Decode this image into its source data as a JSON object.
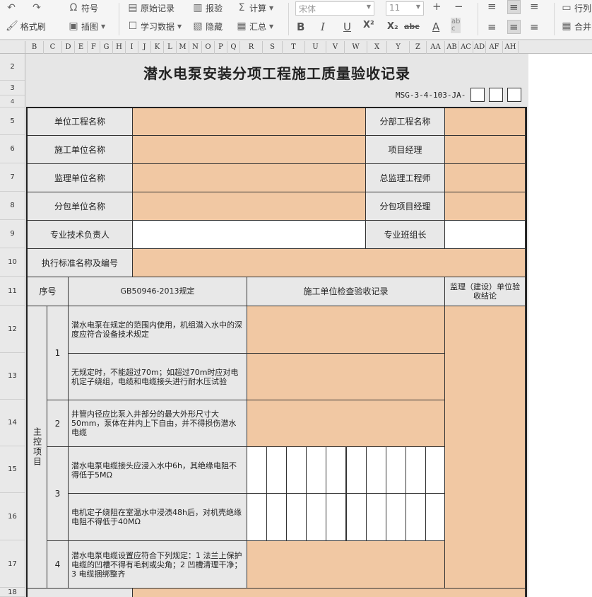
{
  "toolbar": {
    "undo_icon": "undo-arrow-icon",
    "redo_icon": "redo-arrow-icon",
    "symbol_label": "符号",
    "format_painter_label": "格式刷",
    "illustration_label": "插图",
    "original_record_label": "原始记录",
    "study_data_label": "学习数据",
    "report_label": "报验",
    "hide_label": "隐藏",
    "calculate_label": "计算",
    "summary_label": "汇总",
    "font_name_placeholder": "宋体",
    "font_size_placeholder": "11",
    "bold": "B",
    "italic": "I",
    "underline": "U",
    "superscript": "X²",
    "subscript": "X₂",
    "strikethrough": "abc",
    "font_color": "A",
    "row_label": "行列",
    "merge_label": "合并"
  },
  "columns": [
    "B",
    "C",
    "D",
    "E",
    "F",
    "G",
    "H",
    "I",
    "J",
    "K",
    "L",
    "M",
    "N",
    "O",
    "P",
    "Q",
    "R",
    "S",
    "T",
    "U",
    "V",
    "W",
    "X",
    "Y",
    "Z",
    "AA",
    "AB",
    "AC",
    "AD",
    "AF",
    "AH"
  ],
  "rows": [
    "2",
    "3",
    "4",
    "5",
    "6",
    "7",
    "8",
    "9",
    "10",
    "11",
    "12",
    "13",
    "14",
    "15",
    "16",
    "17",
    "18"
  ],
  "sheet": {
    "title": "潜水电泵安装分项工程施工质量验收记录",
    "doc_code": "MSG-3-4-103-JA-",
    "labels": {
      "unit_project": "单位工程名称",
      "sub_project": "分部工程名称",
      "construction_unit": "施工单位名称",
      "project_manager": "项目经理",
      "supervision_unit": "监理单位名称",
      "chief_supervisor": "总监理工程师",
      "subcontract_unit": "分包单位名称",
      "subcontract_manager": "分包项目经理",
      "tech_leader": "专业技术负责人",
      "team_leader": "专业班组长",
      "standard": "执行标准名称及编号"
    },
    "table_header": {
      "seq": "序号",
      "spec": "GB50946-2013规定",
      "inspection": "施工单位检查验收记录",
      "conclusion": "监理（建设）单位验收结论"
    },
    "group_label": "主控项目",
    "items": [
      {
        "no": "1",
        "text": "潜水电泵在规定的范围内使用，机组潜入水中的深度应符合设备技术规定"
      },
      {
        "no": "",
        "text": "无规定时，不能超过70m；如超过70m时应对电机定子绕组，电缆和电缆接头进行耐水压试验"
      },
      {
        "no": "2",
        "text": "井管内径应比泵入井部分的最大外形尺寸大50mm，泵体在井内上下自由，并不得损伤潜水电缆"
      },
      {
        "no": "3",
        "text": "潜水电泵电缆接头应浸入水中6h，其绝缘电阻不得低于5MΩ"
      },
      {
        "no": "",
        "text": "电机定子绕阻在室温水中浸渍48h后，对机壳绝缘电阻不得低于40MΩ"
      },
      {
        "no": "4",
        "text": "潜水电泵电缆设置应符合下列规定：1 法兰上保护电缆的凹槽不得有毛刺或尖角；2 凹槽清理干净；3 电缆捆绑整齐"
      }
    ]
  }
}
